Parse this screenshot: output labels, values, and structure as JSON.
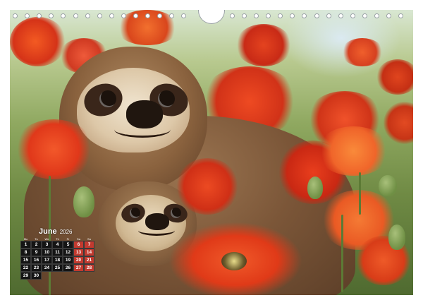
{
  "calendar": {
    "month": "June",
    "year": "2026",
    "weekdays": [
      "Mo",
      "Tu",
      "We",
      "Th",
      "Fr",
      "Sa",
      "Su"
    ],
    "weeks": [
      [
        "1",
        "2",
        "3",
        "4",
        "5",
        "6",
        "7"
      ],
      [
        "8",
        "9",
        "10",
        "11",
        "12",
        "13",
        "14"
      ],
      [
        "15",
        "16",
        "17",
        "18",
        "19",
        "20",
        "21"
      ],
      [
        "22",
        "23",
        "24",
        "25",
        "26",
        "27",
        "28"
      ],
      [
        "29",
        "30",
        "",
        "",
        "",
        "",
        ""
      ]
    ]
  },
  "photo": {
    "subject": "sloth mother and baby among red poppies",
    "accent_colors": [
      "#e2431b",
      "#c82a16",
      "#f26a2a",
      "#6f8a44"
    ]
  },
  "binding": {
    "icon": "spiral-binding-holes"
  }
}
